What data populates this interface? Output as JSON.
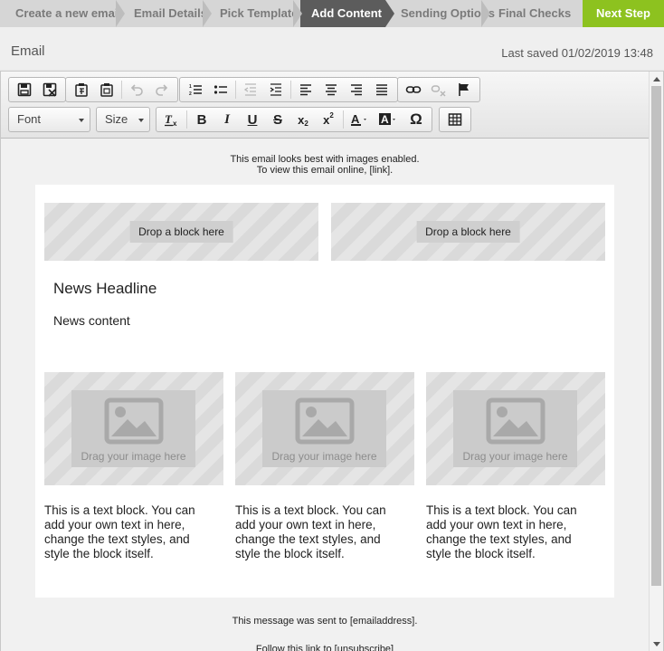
{
  "steps": [
    {
      "label": "Create a new email"
    },
    {
      "label": "Email Details"
    },
    {
      "label": "Pick Template"
    },
    {
      "label": "Add Content"
    },
    {
      "label": "Sending Options"
    },
    {
      "label": "Final Checks"
    }
  ],
  "active_step": "Add Content",
  "next_step_label": "Next Step",
  "page_title": "Email",
  "last_saved": "Last saved 01/02/2019 13:48",
  "toolbar": {
    "font_label": "Font",
    "size_label": "Size",
    "icons": [
      "save-icon",
      "save-as-template-icon",
      "paste-icon",
      "paste-text-icon",
      "undo-icon",
      "redo-icon",
      "numbered-list-icon",
      "bulleted-list-icon",
      "decrease-indent-icon",
      "increase-indent-icon",
      "align-left-icon",
      "align-center-icon",
      "align-right-icon",
      "justify-icon",
      "link-icon",
      "unlink-icon",
      "anchor-flag-icon",
      "clear-format-icon",
      "bold-icon",
      "italic-icon",
      "underline-icon",
      "strikethrough-icon",
      "subscript-icon",
      "superscript-icon",
      "text-color-icon",
      "background-color-icon",
      "special-character-icon",
      "table-icon"
    ]
  },
  "canvas": {
    "preheader_line1": "This email looks best with images enabled.",
    "preheader_line2": "To view this email online, [link].",
    "drop_block_label": "Drop a block here",
    "headline": "News Headline",
    "news_content": "News content",
    "image_placeholder_label": "Drag your image here",
    "text_block": "This is a text block. You can add your own text in here, change the text styles, and style the block itself.",
    "footer_line1": "This message was sent to [emailaddress].",
    "footer_line2": "Follow this link to [unsubscribe]"
  },
  "colors": {
    "next_step_bg": "#8dc21f",
    "active_step_bg": "#5c5c5c",
    "step_bar_bg": "#d6d6d6"
  }
}
